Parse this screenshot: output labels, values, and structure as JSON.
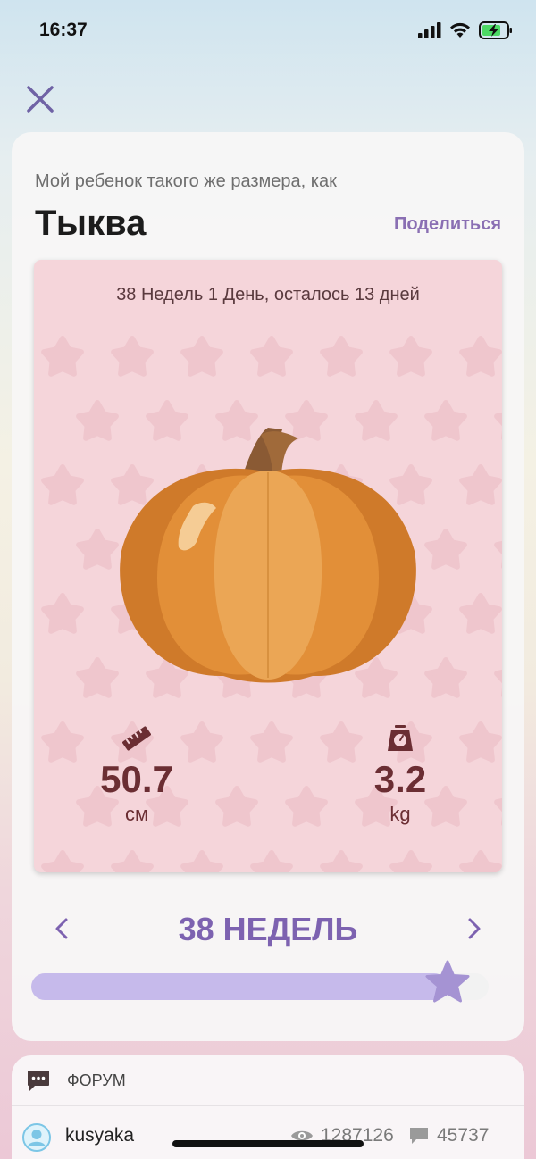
{
  "status_bar": {
    "time": "16:37"
  },
  "header": {
    "subtitle": "Мой ребенок такого же размера, как",
    "title": "Тыква",
    "share_label": "Поделиться"
  },
  "fruit_card": {
    "week_info": "38 Недель 1 День, осталось 13 дней",
    "image": "pumpkin-illustration",
    "length": {
      "icon": "ruler-icon",
      "value": "50.7",
      "unit": "см"
    },
    "weight": {
      "icon": "scale-icon",
      "value": "3.2",
      "unit": "kg"
    }
  },
  "week_nav": {
    "label": "38 НЕДЕЛЬ",
    "prev_icon": "chevron-left-icon",
    "next_icon": "chevron-right-icon",
    "progress_fraction": 0.91
  },
  "forum": {
    "label": "ФОРУМ",
    "post": {
      "username": "kusyaka",
      "views": "1287126",
      "comments": "45737"
    }
  },
  "colors": {
    "accent": "#7d62b0",
    "card_pink": "#f5d5da",
    "stat_text": "#6b2e33",
    "slider_fill": "#c6baeb",
    "thumb": "#a593d3"
  }
}
